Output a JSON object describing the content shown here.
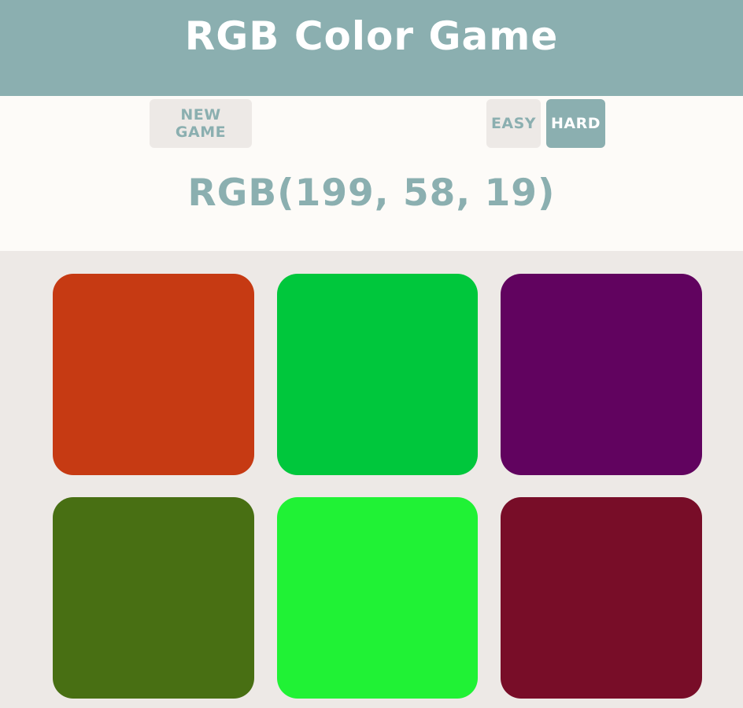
{
  "header": {
    "title_first": "RGB",
    "title_rest": "Color Game",
    "background": "#8bafb0"
  },
  "controls": {
    "new_game_label": "new game",
    "easy_label": "easy",
    "hard_label": "hard",
    "selected_mode": "hard"
  },
  "target": {
    "label": "RGB(199, 58, 19)"
  },
  "colors": {
    "accent": "#8bafb0",
    "panel": "#fdfbf8",
    "board": "#ede9e6"
  },
  "swatches": [
    {
      "color": "#c63a13"
    },
    {
      "color": "#00c73c"
    },
    {
      "color": "#61035f"
    },
    {
      "color": "#486f13"
    },
    {
      "color": "#20f235"
    },
    {
      "color": "#780d28"
    }
  ]
}
